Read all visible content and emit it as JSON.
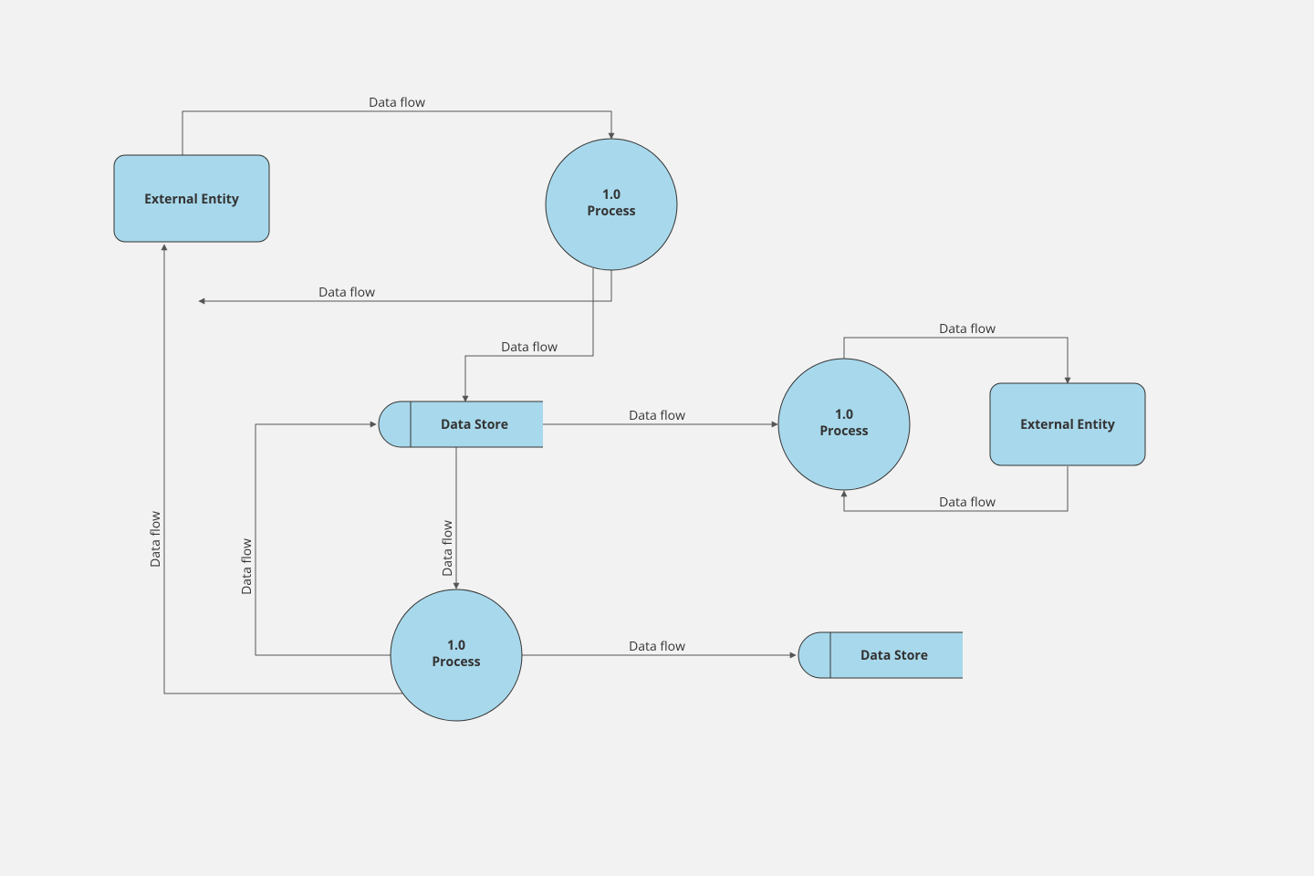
{
  "diagram": {
    "type": "data-flow-diagram",
    "colors": {
      "nodeFill": "#a8d8eb",
      "nodeStroke": "#333333",
      "edge": "#555555",
      "bg": "#f2f2f2"
    },
    "nodes": {
      "entity1": {
        "kind": "external-entity",
        "label": "External Entity"
      },
      "process1": {
        "kind": "process",
        "number": "1.0",
        "label": "Process"
      },
      "store1": {
        "kind": "data-store",
        "label": "Data Store"
      },
      "process2": {
        "kind": "process",
        "number": "1.0",
        "label": "Process"
      },
      "entity2": {
        "kind": "external-entity",
        "label": "External Entity"
      },
      "process3": {
        "kind": "process",
        "number": "1.0",
        "label": "Process"
      },
      "store2": {
        "kind": "data-store",
        "label": "Data Store"
      }
    },
    "edges": {
      "e1": {
        "from": "entity1",
        "to": "process1",
        "label": "Data flow"
      },
      "e2": {
        "from": "process1",
        "to": "entity1",
        "label": "Data flow"
      },
      "e3": {
        "from": "process1",
        "to": "store1",
        "label": "Data flow"
      },
      "e4": {
        "from": "store1",
        "to": "process2",
        "label": "Data flow"
      },
      "e5": {
        "from": "process2",
        "to": "entity2",
        "label": "Data flow"
      },
      "e6": {
        "from": "entity2",
        "to": "process2",
        "label": "Data flow"
      },
      "e7": {
        "from": "store1",
        "to": "process3",
        "label": "Data flow"
      },
      "e8": {
        "from": "process3",
        "to": "store1",
        "label": "Data flow"
      },
      "e9": {
        "from": "process3",
        "to": "entity1",
        "label": "Data flow"
      },
      "e10": {
        "from": "process3",
        "to": "store2",
        "label": "Data flow"
      }
    }
  }
}
